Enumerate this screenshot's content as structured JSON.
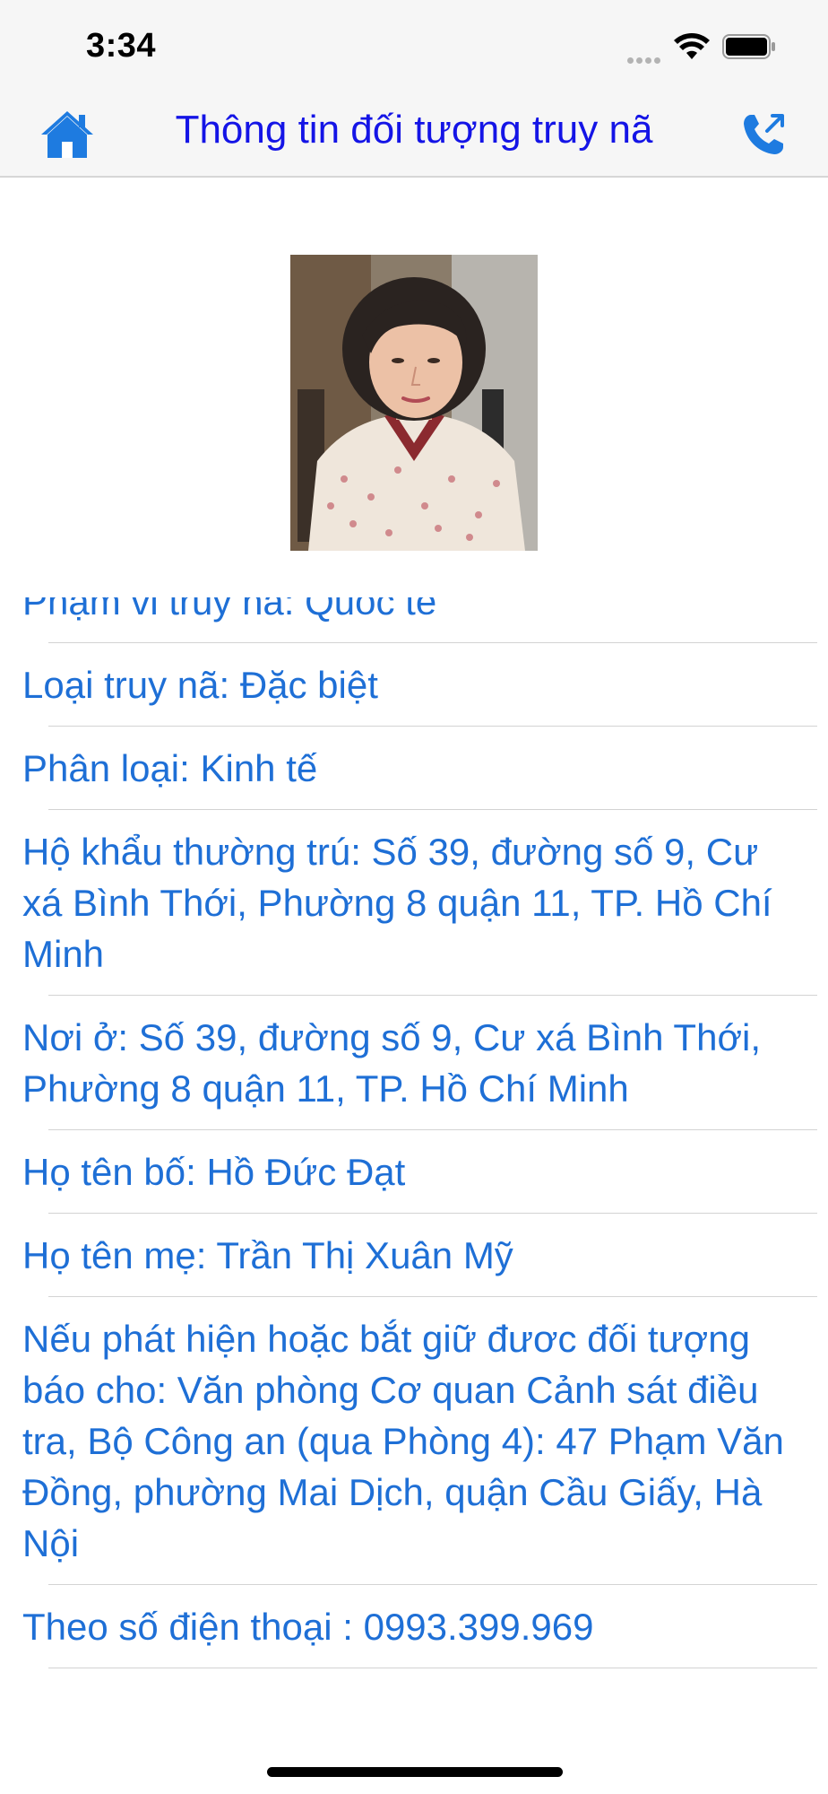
{
  "status_bar": {
    "time": "3:34"
  },
  "nav": {
    "title": "Thông tin đối tượng truy nã",
    "home_icon": "house-icon",
    "call_icon": "phone-outgoing-icon",
    "accent_color": "#1414e6"
  },
  "photo": {
    "subject": "portrait-photo"
  },
  "info": {
    "text_color": "#1e6fd6",
    "rows": [
      "Phạm vi truy nã: Quốc tế",
      "Loại truy nã: Đặc biệt",
      "Phân loại:  Kinh tế",
      "Hộ khẩu thường trú:  Số 39, đường số 9, Cư xá Bình Thới, Phường 8 quận 11, TP. Hồ Chí Minh",
      "Nơi ở: Số 39, đường số 9, Cư xá Bình Thới, Phường 8 quận 11, TP. Hồ Chí Minh",
      "Họ tên bố: Hồ Đức Đạt",
      "Họ tên mẹ: Trần Thị Xuân Mỹ",
      "Nếu phát hiện hoặc bắt giữ đươc đối tượng báo cho: Văn phòng Cơ quan Cảnh sát điều tra, Bộ Công an (qua Phòng 4): 47 Phạm Văn Đồng, phường Mai Dịch, quận Cầu Giấy, Hà Nội",
      "Theo số điện thoại : 0993.399.969"
    ]
  }
}
